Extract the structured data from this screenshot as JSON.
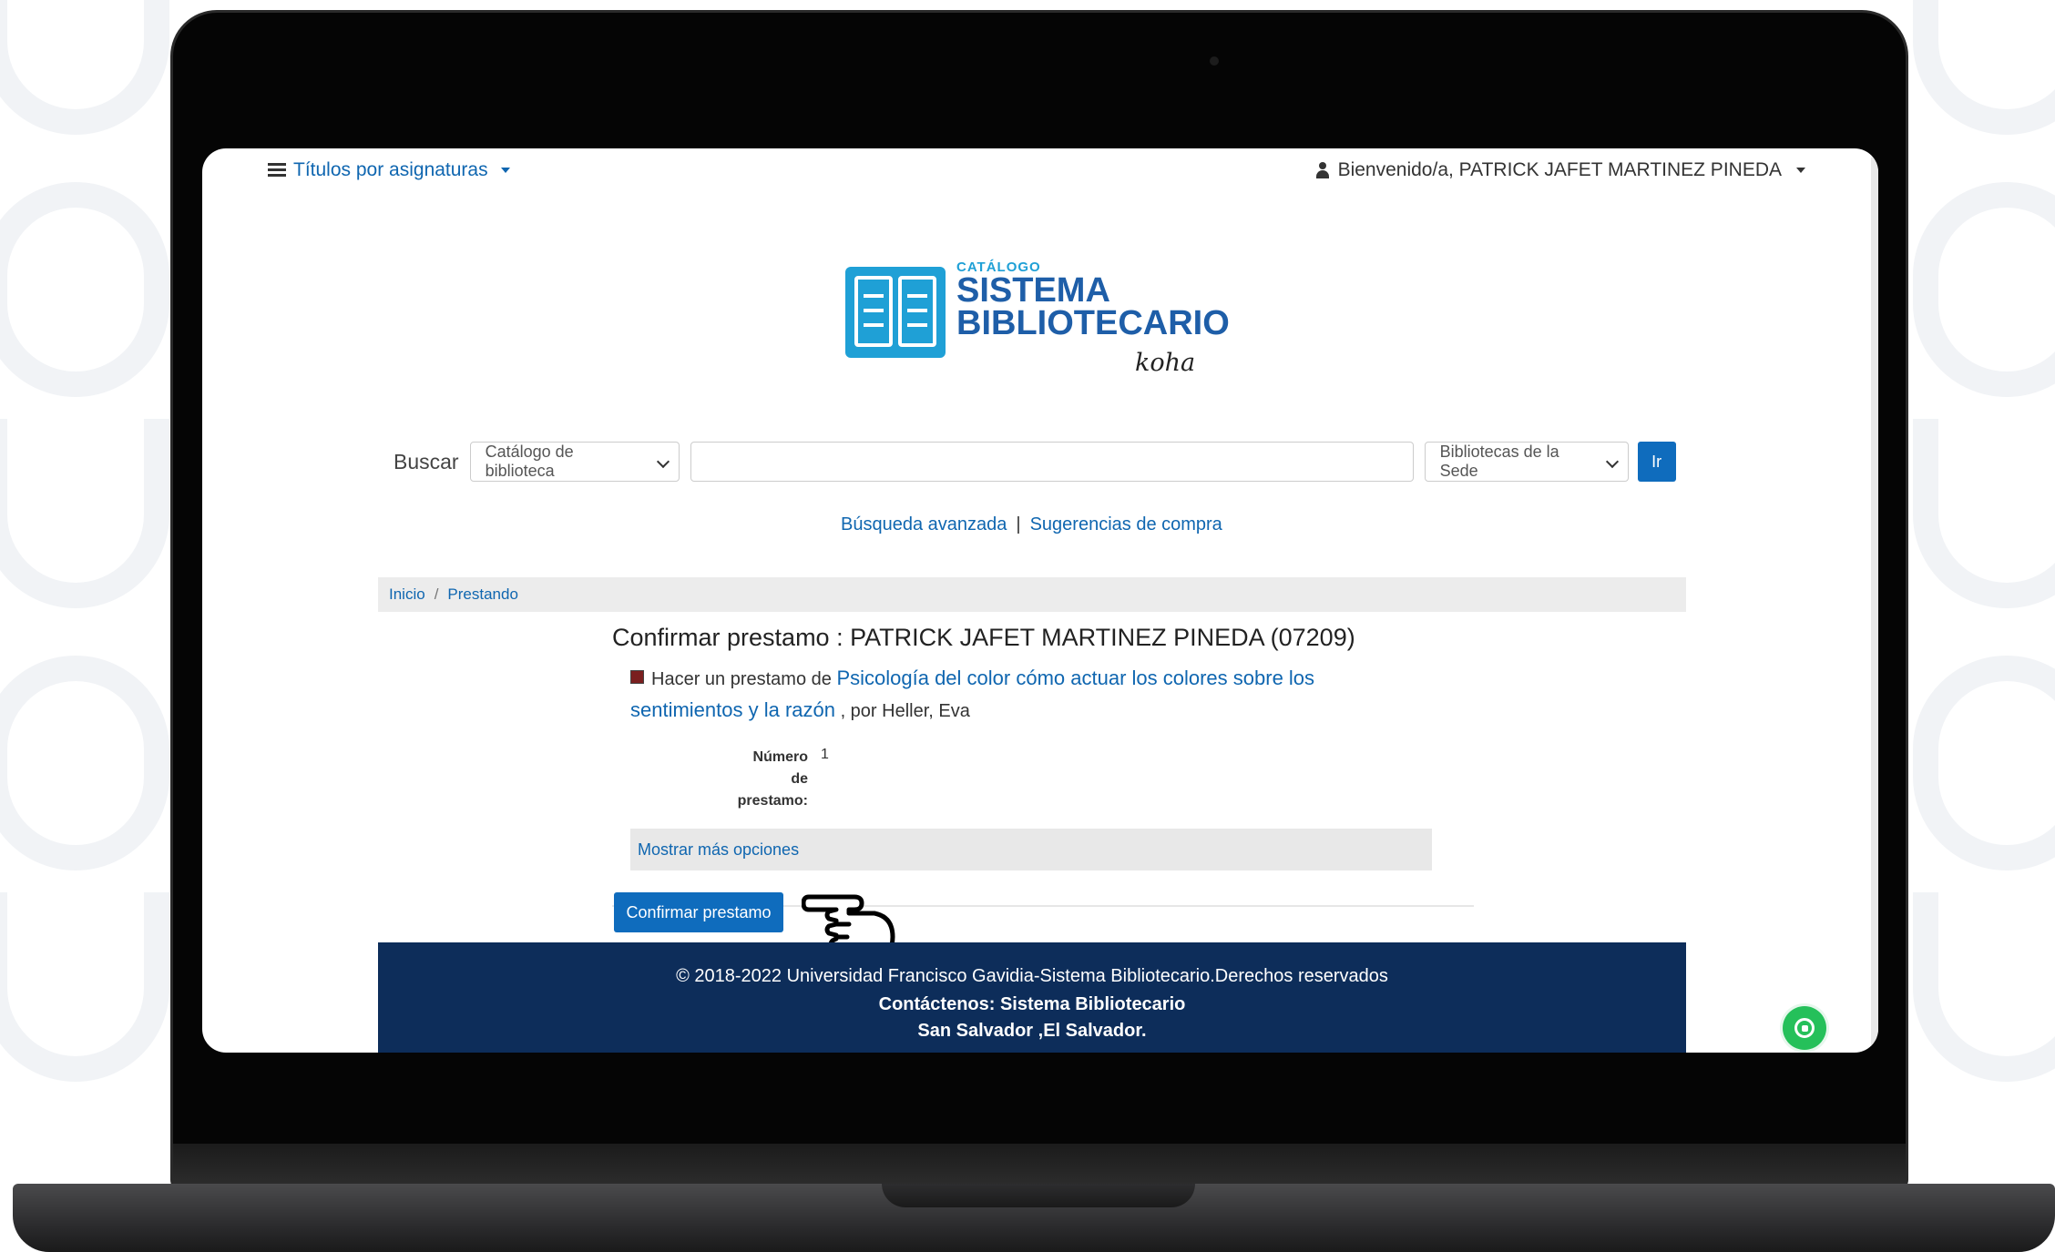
{
  "nav": {
    "left_label": "Títulos por asignaturas",
    "right_label": "Bienvenido/a, PATRICK JAFET MARTINEZ PINEDA"
  },
  "logo": {
    "small": "CATÁLOGO",
    "line1": "SISTEMA",
    "line2": "BIBLIOTECARIO",
    "koha": "koha"
  },
  "search": {
    "label": "Buscar",
    "catalog_select": "Catálogo de biblioteca",
    "input_value": "",
    "library_select": "Bibliotecas de la Sede",
    "go_label": "Ir"
  },
  "links": {
    "advanced": "Búsqueda avanzada",
    "separator": "|",
    "suggestions": "Sugerencias de compra"
  },
  "breadcrumb": {
    "home": "Inicio",
    "separator": "/",
    "current": "Prestando"
  },
  "content": {
    "title": "Confirmar prestamo : PATRICK JAFET MARTINEZ PINEDA (07209)",
    "loan_prefix": "Hacer un prestamo de",
    "book_title": "Psicología del color cómo actuar los colores sobre los sentimientos y la razón",
    "book_author": ", por Heller, Eva",
    "loan_number_label": "Número de prestamo:",
    "loan_number_value": "1",
    "more_options": "Mostrar más opciones",
    "confirm_button": "Confirmar prestamo"
  },
  "footer": {
    "line1": "© 2018-2022 Universidad Francisco Gavidia-Sistema Bibliotecario.Derechos reservados",
    "line2": "Contáctenos: Sistema Bibliotecario",
    "line3": "San Salvador ,El Salvador."
  },
  "colors": {
    "accent": "#0f6cbd",
    "footer": "#0d2d5a",
    "logo_blue": "#1fa0d6",
    "whatsapp": "#25c05a"
  },
  "icons": {
    "nav_left": "list-icon",
    "nav_right": "user-icon",
    "pointer": "hand-pointer-icon",
    "chat": "whatsapp-icon"
  }
}
